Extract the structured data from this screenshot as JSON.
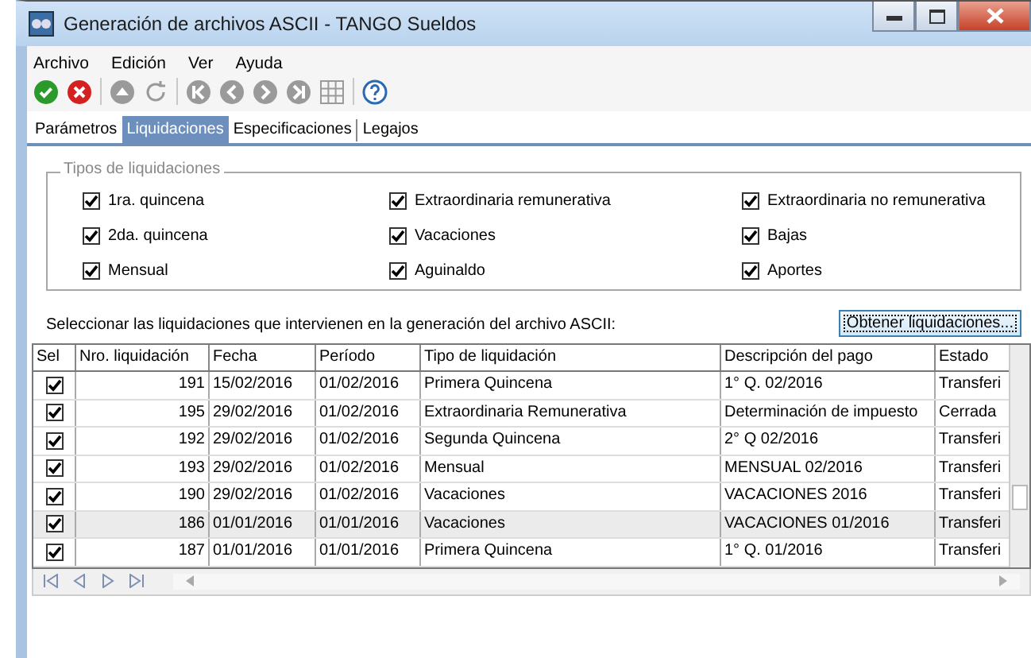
{
  "window": {
    "title": "Generación de archivos ASCII - TANGO Sueldos"
  },
  "menu": [
    "Archivo",
    "Edición",
    "Ver",
    "Ayuda"
  ],
  "toolbar": [
    {
      "kind": "ok",
      "disabled": false
    },
    {
      "kind": "cancel",
      "disabled": false
    },
    {
      "kind": "sep"
    },
    {
      "kind": "up",
      "disabled": true
    },
    {
      "kind": "refresh",
      "disabled": true
    },
    {
      "kind": "sep"
    },
    {
      "kind": "first",
      "disabled": true
    },
    {
      "kind": "prev",
      "disabled": true
    },
    {
      "kind": "next",
      "disabled": true
    },
    {
      "kind": "last",
      "disabled": true
    },
    {
      "kind": "grid",
      "disabled": true
    },
    {
      "kind": "sep"
    },
    {
      "kind": "help",
      "disabled": false
    }
  ],
  "tabs": [
    {
      "label": "Parámetros",
      "selected": false
    },
    {
      "label": "Liquidaciones",
      "selected": true
    },
    {
      "label": "Especificaciones",
      "selected": false
    },
    {
      "label": "Legajos",
      "selected": false
    }
  ],
  "group": {
    "title": "Tipos de liquidaciones",
    "options": [
      {
        "label": "1ra. quincena",
        "checked": true
      },
      {
        "label": "Extraordinaria remunerativa",
        "checked": true
      },
      {
        "label": "Extraordinaria no remunerativa",
        "checked": true
      },
      {
        "label": "2da. quincena",
        "checked": true
      },
      {
        "label": "Vacaciones",
        "checked": true
      },
      {
        "label": "Bajas",
        "checked": true
      },
      {
        "label": "Mensual",
        "checked": true
      },
      {
        "label": "Aguinaldo",
        "checked": true
      },
      {
        "label": "Aportes",
        "checked": true
      }
    ]
  },
  "prompt": "Seleccionar las liquidaciones que intervienen en la generación del archivo ASCII:",
  "get_button": "Obtener liquidaciones...",
  "table": {
    "select_column": "Sel",
    "columns": [
      "Nro. liquidación",
      "Fecha",
      "Período",
      "Tipo de liquidación",
      "Descripción del pago",
      "Estado"
    ],
    "rows": [
      {
        "checked": true,
        "selected": false,
        "cells": [
          "191",
          "15/02/2016",
          "01/02/2016",
          "Primera Quincena",
          "1° Q. 02/2016",
          "Transferi"
        ]
      },
      {
        "checked": true,
        "selected": false,
        "cells": [
          "195",
          "29/02/2016",
          "01/02/2016",
          "Extraordinaria Remunerativa",
          "Determinación de impuesto",
          "Cerrada"
        ]
      },
      {
        "checked": true,
        "selected": false,
        "cells": [
          "192",
          "29/02/2016",
          "01/02/2016",
          "Segunda Quincena",
          "2° Q 02/2016",
          "Transferi"
        ]
      },
      {
        "checked": true,
        "selected": false,
        "cells": [
          "193",
          "29/02/2016",
          "01/02/2016",
          "Mensual",
          "MENSUAL 02/2016",
          "Transferi"
        ]
      },
      {
        "checked": true,
        "selected": false,
        "cells": [
          "190",
          "29/02/2016",
          "01/02/2016",
          "Vacaciones",
          "VACACIONES 2016",
          "Transferi"
        ]
      },
      {
        "checked": true,
        "selected": true,
        "cells": [
          "186",
          "01/01/2016",
          "01/01/2016",
          "Vacaciones",
          "VACACIONES 01/2016",
          "Transferi"
        ]
      },
      {
        "checked": true,
        "selected": false,
        "cells": [
          "187",
          "01/01/2016",
          "01/01/2016",
          "Primera Quincena",
          "1° Q. 01/2016",
          "Transferi"
        ]
      }
    ]
  }
}
